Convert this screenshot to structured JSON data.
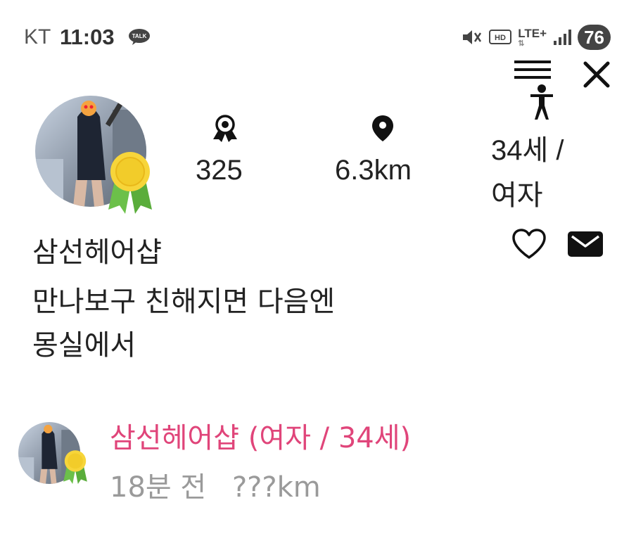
{
  "status_bar": {
    "carrier": "KT",
    "time": "11:03",
    "talk_badge": "TALK",
    "network": "LTE+",
    "battery": "76"
  },
  "icons": {
    "menu": "menu-person-icon",
    "close": "close-icon",
    "medal": "medal-icon",
    "location": "location-pin-icon",
    "heart": "heart-icon",
    "mail": "mail-icon"
  },
  "profile": {
    "points": "325",
    "distance": "6.3km",
    "age": "34세 /",
    "gender": "여자",
    "nickname": "삼선헤어샵",
    "bio_line1": "만나보구 친해지면 다음엔",
    "bio_line2": "몽실에서"
  },
  "post": {
    "title": "삼선헤어샵 (여자 / 34세)",
    "time_ago": "18분 전",
    "distance": "???km"
  },
  "colors": {
    "accent_pink": "#e0457a",
    "meta_gray": "#9a9a9a",
    "medal_gold": "#f2cc2a",
    "ribbon_green": "#6cc04a"
  }
}
